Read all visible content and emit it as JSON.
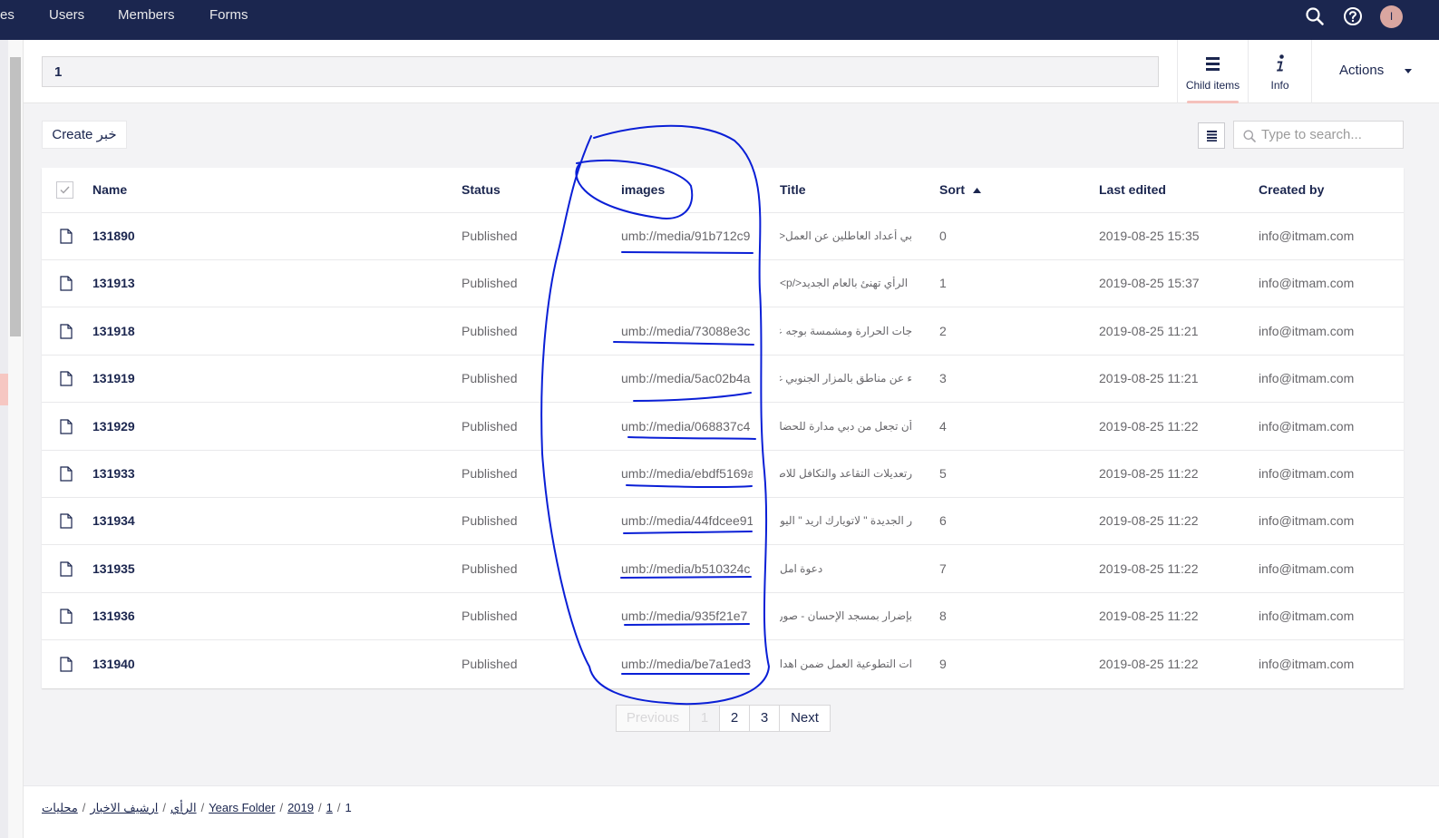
{
  "topnav": {
    "items": [
      "es",
      "Users",
      "Members",
      "Forms"
    ],
    "avatar_initial": "I"
  },
  "header": {
    "name_value": "1",
    "apps": [
      {
        "label": "Child items",
        "icon": "list-icon"
      },
      {
        "label": "Info",
        "icon": "info-icon"
      }
    ],
    "actions_label": "Actions"
  },
  "toolbar": {
    "create_label": "Create خبر",
    "search_placeholder": "Type to search..."
  },
  "table": {
    "columns": [
      "Name",
      "Status",
      "images",
      "Title",
      "Sort",
      "Last edited",
      "Created by"
    ],
    "rows": [
      {
        "name": "131890",
        "status": "Published",
        "image": "umb://media/91b712c9",
        "title": "بي أعداد العاطلين عن العمل<p>",
        "sort": "0",
        "edited": "2019-08-25 15:35",
        "created": "info@itmam.com"
      },
      {
        "name": "131913",
        "status": "Published",
        "image": "",
        "title": "الرأي تهنئ بالعام الجديد</p>",
        "sort": "1",
        "edited": "2019-08-25 15:37",
        "created": "info@itmam.com"
      },
      {
        "name": "131918",
        "status": "Published",
        "image": "umb://media/73088e3c",
        "title": "جات الحرارة ومشمسة بوجه عام",
        "sort": "2",
        "edited": "2019-08-25 11:21",
        "created": "info@itmam.com"
      },
      {
        "name": "131919",
        "status": "Published",
        "image": "umb://media/5ac02b4a",
        "title": "ء عن مناطق بالمزار الجنوبي غدا",
        "sort": "3",
        "edited": "2019-08-25 11:21",
        "created": "info@itmam.com"
      },
      {
        "name": "131929",
        "status": "Published",
        "image": "umb://media/068837c4",
        "title": "أن تجعل من دبي مدارة للحضارة",
        "sort": "4",
        "edited": "2019-08-25 11:22",
        "created": "info@itmam.com"
      },
      {
        "name": "131933",
        "status": "Published",
        "image": "umb://media/ebdf5169a",
        "title": "رتعديلات التقاعد والتكافل للاطباء",
        "sort": "5",
        "edited": "2019-08-25 11:22",
        "created": "info@itmam.com"
      },
      {
        "name": "131934",
        "status": "Published",
        "image": "umb://media/44fdcee91",
        "title": "ر الجديدة \" لاتويارك اريد \" اليوم",
        "sort": "6",
        "edited": "2019-08-25 11:22",
        "created": "info@itmam.com"
      },
      {
        "name": "131935",
        "status": "Published",
        "image": "umb://media/b510324c",
        "title": "دعوة امل",
        "sort": "7",
        "edited": "2019-08-25 11:22",
        "created": "info@itmam.com"
      },
      {
        "name": "131936",
        "status": "Published",
        "image": "umb://media/935f21e7",
        "title": "بإضرار بمسجد الإحسان - صور",
        "sort": "8",
        "edited": "2019-08-25 11:22",
        "created": "info@itmam.com"
      },
      {
        "name": "131940",
        "status": "Published",
        "image": "umb://media/be7a1ed3",
        "title": "ات التطوعية العمل ضمن اهدافها",
        "sort": "9",
        "edited": "2019-08-25 11:22",
        "created": "info@itmam.com"
      }
    ]
  },
  "pagination": {
    "previous": "Previous",
    "pages": [
      "1",
      "2",
      "3"
    ],
    "current": "1",
    "next": "Next"
  },
  "breadcrumb": [
    "الرأي",
    "ارشيف الاخبار",
    "محليات",
    "Years Folder",
    "2019",
    "1",
    "1"
  ],
  "colors": {
    "nav_bg": "#1b264f",
    "accent_pink": "#f5c1bc",
    "annotation_blue": "#0a1fd6"
  }
}
